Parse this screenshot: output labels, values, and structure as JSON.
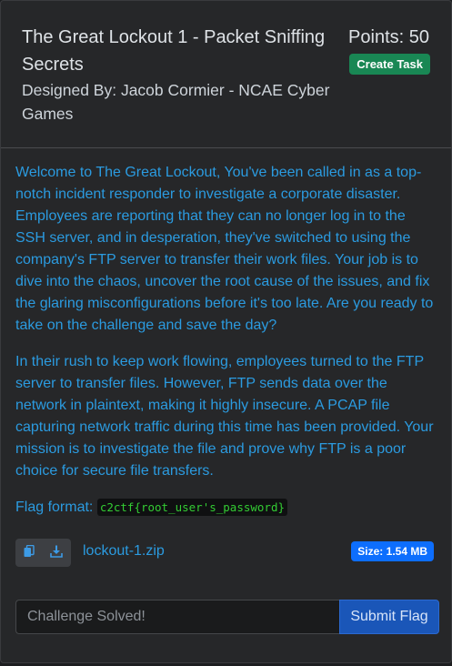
{
  "challenge": {
    "title": "The Great Lockout 1 - Packet Sniffing Secrets",
    "designer": "Designed By: Jacob Cormier - NCAE Cyber Games",
    "points": "Points: 50",
    "create_task_label": "Create Task"
  },
  "description": {
    "paragraphs": [
      "Welcome to The Great Lockout, You've been called in as a top-notch incident responder to investigate a corporate disaster. Employees are reporting that they can no longer log in to the SSH server, and in desperation, they've switched to using the company's FTP server to transfer their work files. Your job is to dive into the chaos, uncover the root cause of the issues, and fix the glaring misconfigurations before it's too late. Are you ready to take on the challenge and save the day?",
      "In their rush to keep work flowing, employees turned to the FTP server to transfer files. However, FTP sends data over the network in plaintext, making it highly insecure. A PCAP file capturing network traffic during this time has been provided. Your mission is to investigate the file and prove why FTP is a poor choice for secure file transfers."
    ],
    "flag_format_label": "Flag format:",
    "flag_format_value": "c2ctf{root_user's_password}"
  },
  "file": {
    "copy_icon": "copy-icon",
    "download_icon": "download-icon",
    "name": "lockout-1.zip",
    "size": "Size: 1.54 MB"
  },
  "submission": {
    "placeholder": "Challenge Solved!",
    "submit_label": "Submit Flag"
  },
  "colors": {
    "accent_link": "#2b9be0",
    "success": "#198754",
    "primary": "#0d6efd"
  }
}
